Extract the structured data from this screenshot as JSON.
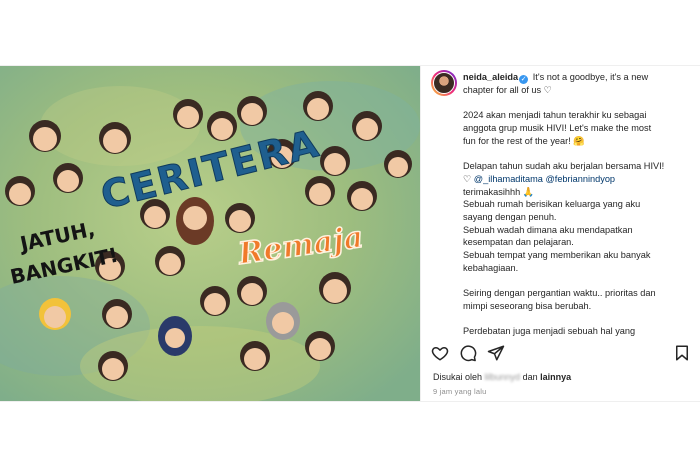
{
  "post": {
    "image_text": {
      "title_word_1": "CERITERA",
      "title_word_2": "Remaja",
      "left_line_1": "JATUH,",
      "left_line_2": "BANGKIT!"
    },
    "username": "neida_aleida",
    "caption_lines": [
      "It's not a goodbye, it's a new",
      "chapter for all of us ♡",
      "",
      "2024 akan menjadi tahun terakhir ku sebagai",
      "anggota grup musik HIVI! Let's make the most",
      "fun for the rest of the year! 🤗",
      "",
      "Delapan tahun sudah aku berjalan bersama HIVI!",
      "terimakasihhh 🙏",
      "Sebuah rumah berisikan keluarga yang aku",
      "sayang dengan penuh.",
      "Sebuah wadah dimana aku mendapatkan",
      "kesempatan dan pelajaran.",
      "Sebuah tempat yang memberikan aku banyak",
      "kebahagiaan.",
      "",
      "Seiring dengan pergantian waktu.. prioritas dan",
      "mimpi seseorang bisa berubah.",
      "",
      "Perdebatan juga menjadi sebuah hal yang"
    ],
    "mention_prefix": "♡ ",
    "mention_1": "@_ilhamaditama",
    "mention_2": "@febriannindyop",
    "likes_prefix": "Disukai oleh ",
    "likes_user": "lilbunnyd",
    "likes_middle": " dan ",
    "likes_others": "lainnya",
    "time_ago": "9 jam yang lalu",
    "icons": [
      "heart-icon",
      "comment-icon",
      "share-icon",
      "bookmark-icon"
    ],
    "colors": {
      "accent_blue": "#3897f0",
      "mention": "#00376b",
      "title_blue": "#1f5f8f",
      "title_orange": "#f07a2a"
    }
  }
}
